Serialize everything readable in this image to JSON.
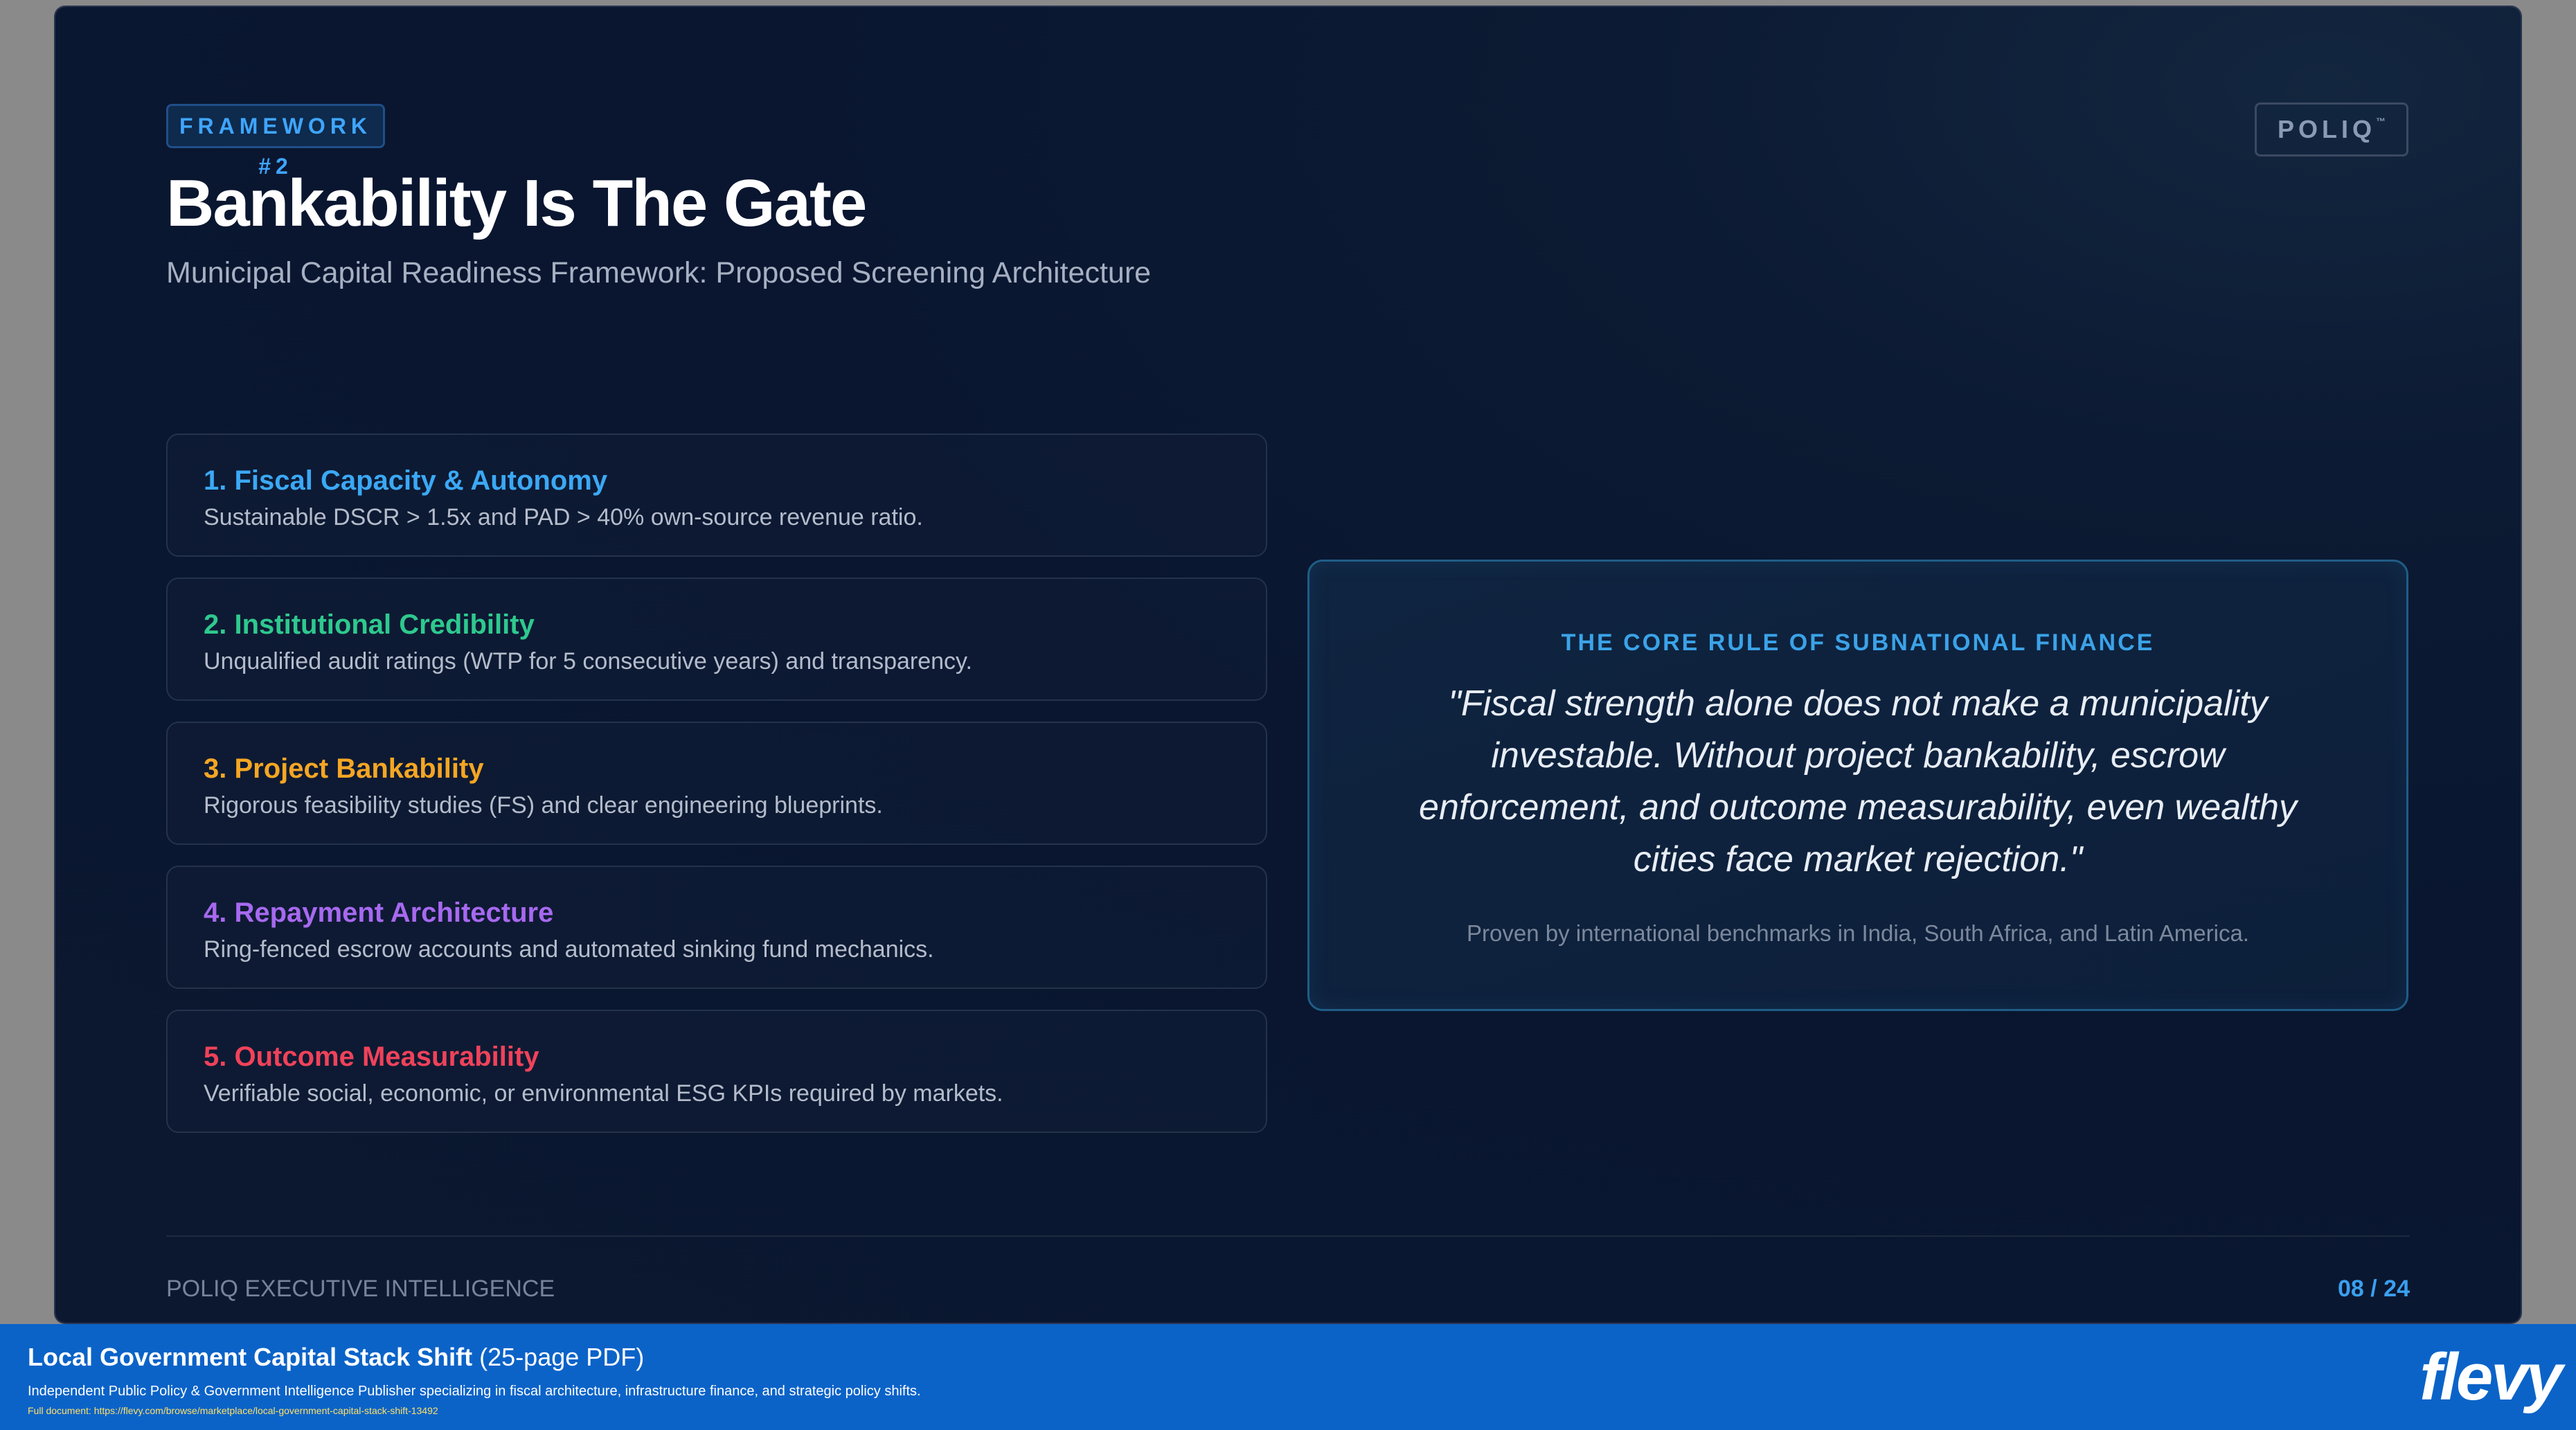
{
  "slide": {
    "tag": "FRAMEWORK #2",
    "logo": {
      "text": "POLIQ",
      "mark": "™"
    },
    "title": "Bankability Is The Gate",
    "subtitle": "Municipal Capital Readiness Framework: Proposed Screening Architecture",
    "items": [
      {
        "title": "1. Fiscal Capacity & Autonomy",
        "desc": "Sustainable DSCR > 1.5x and PAD > 40% own-source revenue ratio.",
        "color": "#3ba8f5"
      },
      {
        "title": "2. Institutional Credibility",
        "desc": "Unqualified audit ratings (WTP for 5 consecutive years) and transparency.",
        "color": "#2ec98e"
      },
      {
        "title": "3. Project Bankability",
        "desc": "Rigorous feasibility studies (FS) and clear engineering blueprints.",
        "color": "#f5a623"
      },
      {
        "title": "4. Repayment Architecture",
        "desc": "Ring-fenced escrow accounts and automated sinking fund mechanics.",
        "color": "#a769f0"
      },
      {
        "title": "5. Outcome Measurability",
        "desc": "Verifiable social, economic, or environmental ESG KPIs required by markets.",
        "color": "#f0425a"
      }
    ],
    "quote": {
      "label": "THE CORE RULE OF SUBNATIONAL FINANCE",
      "text": "\"Fiscal strength alone does not make a municipality investable. Without project bankability, escrow enforcement, and outcome measurability, even wealthy cities face market rejection.\"",
      "source": "Proven by international benchmarks in India, South Africa, and Latin America."
    },
    "footer": {
      "left": "POLIQ EXECUTIVE INTELLIGENCE",
      "page": "08 / 24"
    }
  },
  "banner": {
    "title": "Local Government Capital Stack Shift",
    "title_suffix": " (25-page PDF)",
    "desc": "Independent Public Policy & Government Intelligence Publisher specializing in fiscal architecture, infrastructure finance, and strategic policy shifts.",
    "link": "Full document: https://flevy.com/browse/marketplace/local-government-capital-stack-shift-13492",
    "brand": "flevy"
  }
}
